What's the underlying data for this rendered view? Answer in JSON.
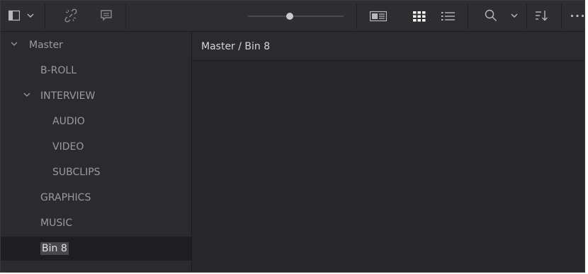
{
  "toolbar": {
    "icons": [
      "sidebar-toggle-icon",
      "chevron-down-icon",
      "unlink-icon",
      "metadata-icon",
      "thumbnail-size-slider",
      "metadata-view-icon",
      "grid-view-icon",
      "list-view-icon",
      "search-icon",
      "chevron-down-icon",
      "sort-icon",
      "more-options-icon"
    ],
    "thumbnail_slider_level": 0.44
  },
  "sidebar": {
    "root": {
      "label": "Master",
      "expanded": true
    },
    "items": [
      {
        "label": "B-ROLL",
        "depth": 1,
        "expandable": false
      },
      {
        "label": "INTERVIEW",
        "depth": 1,
        "expandable": true,
        "expanded": true
      },
      {
        "label": "AUDIO",
        "depth": 2,
        "expandable": false
      },
      {
        "label": "VIDEO",
        "depth": 2,
        "expandable": false
      },
      {
        "label": "SUBCLIPS",
        "depth": 2,
        "expandable": false
      },
      {
        "label": "GRAPHICS",
        "depth": 1,
        "expandable": false
      },
      {
        "label": "MUSIC",
        "depth": 1,
        "expandable": false
      },
      {
        "label": "Bin 8",
        "depth": 1,
        "expandable": false,
        "selected": true
      }
    ]
  },
  "path_bar": {
    "path": "Master / Bin 8"
  },
  "colors": {
    "panel": "#28282b",
    "toolbar": "#2e2e31",
    "text": "#9a9aa0",
    "selected_row": "#1e1e20"
  }
}
